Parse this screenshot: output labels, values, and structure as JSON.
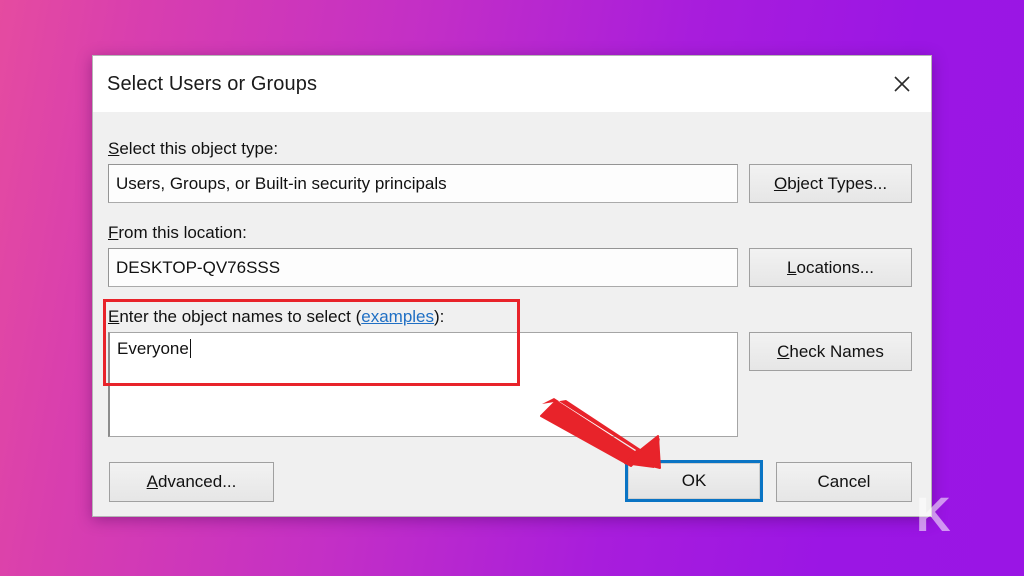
{
  "background": {
    "gradient_from": "#e54ba0",
    "gradient_to": "#9a15e5"
  },
  "watermark": {
    "text": "K"
  },
  "dialog": {
    "title": "Select Users or Groups",
    "close_icon": "close-icon",
    "object_type": {
      "label_prefix": "",
      "label_accel": "S",
      "label_rest": "elect this object type:",
      "value": "Users, Groups, or Built-in security principals",
      "button": {
        "accel": "O",
        "rest": "bject Types..."
      }
    },
    "location": {
      "label_accel": "F",
      "label_rest": "rom this location:",
      "value": "DESKTOP-QV76SSS",
      "button": {
        "accel": "L",
        "rest": "ocations..."
      }
    },
    "object_names": {
      "label_accel": "E",
      "label_mid": "nter the object names to select (",
      "link_text": "examples",
      "label_end": "):",
      "value": "Everyone",
      "button": {
        "accel": "C",
        "rest": "heck Names"
      }
    },
    "footer": {
      "advanced": {
        "accel": "A",
        "rest": "dvanced..."
      },
      "ok": "OK",
      "cancel": "Cancel"
    }
  },
  "annotations": {
    "highlight_color": "#e8232a",
    "arrow_color": "#e8232a",
    "focus_color": "#0a74c4"
  }
}
